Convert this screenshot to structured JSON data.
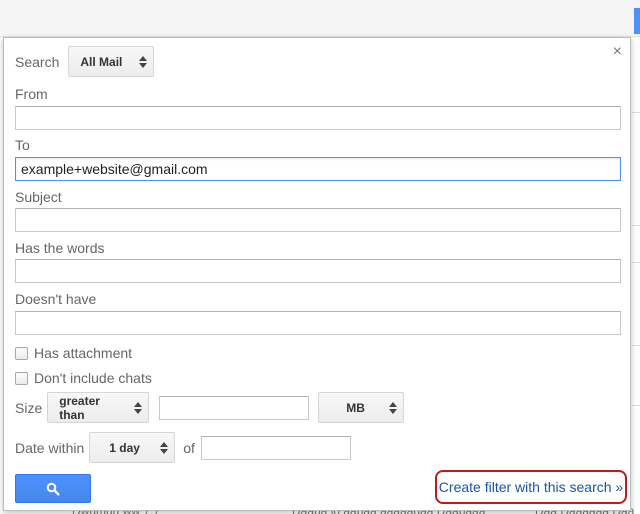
{
  "dialog": {
    "close_label": "×",
    "search_label": "Search",
    "search_scope": "All Mail",
    "from_label": "From",
    "from_value": "",
    "to_label": "To",
    "to_value": "example+website@gmail.com",
    "subject_label": "Subject",
    "subject_value": "",
    "has_words_label": "Has the words",
    "has_words_value": "",
    "doesnt_have_label": "Doesn't have",
    "doesnt_have_value": "",
    "has_attachment_label": "Has attachment",
    "dont_include_chats_label": "Don't include chats",
    "size_label": "Size",
    "size_operator": "greater than",
    "size_value": "",
    "size_unit": "MB",
    "date_within_label": "Date within",
    "date_within_value": "1 day",
    "of_label": "of",
    "date_value": "",
    "create_filter_label": "Create filter with this search »"
  },
  "background": {
    "bottom_fragments": [
      "Dwumgu  ww 7,7",
      "Daapa lo aapaa aaaaagaa Daapaaa",
      "Daa Daaaaaa Daaa"
    ]
  },
  "colors": {
    "accent_blue": "#4d90fe",
    "link_blue": "#1a55a3",
    "highlight_red": "#c0191c"
  },
  "icons": {
    "search_button_icon": "search-icon",
    "close_icon": "close-icon"
  }
}
